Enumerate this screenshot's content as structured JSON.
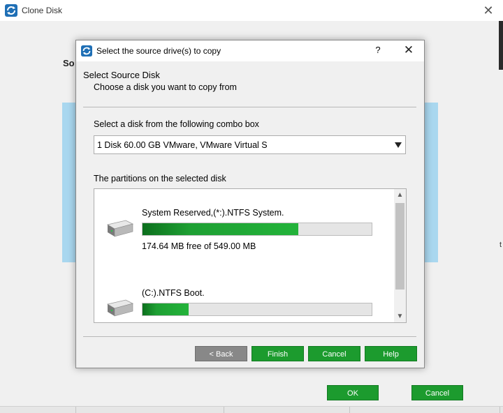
{
  "app": {
    "title": "Clone Disk",
    "heading": "So",
    "ok_label": "OK",
    "cancel_label": "Cancel",
    "edge_text": "t"
  },
  "dialog": {
    "title": "Select the source drive(s) to copy",
    "help_label": "?",
    "close_label": "✕",
    "section_title": "Select Source Disk",
    "section_subtitle": "Choose a disk you want to copy from",
    "combo_label": "Select a disk from the following combo box",
    "combo_value": "1 Disk 60.00 GB VMware,  VMware Virtual S",
    "partitions_label": "The partitions on the selected disk",
    "partitions": [
      {
        "name": "System Reserved,(*:).NTFS System.",
        "free_text": "174.64 MB free of 549.00 MB",
        "used_fraction": 0.68
      },
      {
        "name": "(C:).NTFS Boot.",
        "free_text": "",
        "used_fraction": 0.2
      }
    ],
    "buttons": {
      "back": "< Back",
      "finish": "Finish",
      "cancel": "Cancel",
      "help": "Help"
    }
  },
  "colors": {
    "accent_green": "#1c9b2e",
    "panel_blue": "#a9d7ef",
    "disabled_gray": "#888888"
  },
  "icons": {
    "app_logo": "clone-disk-logo-icon",
    "disk": "hard-disk-icon"
  }
}
